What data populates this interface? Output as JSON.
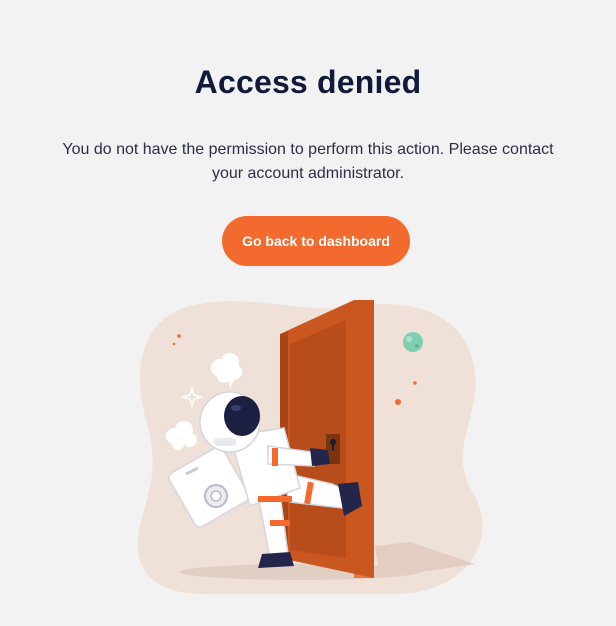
{
  "page": {
    "title": "Access denied",
    "message": "You do not have the permission to perform this action. Please contact your account administrator.",
    "cta_label": "Go back to dashboard"
  },
  "colors": {
    "background": "#f2f2f2",
    "title": "#121a3a",
    "accent": "#f26a2e",
    "blob": "#f0e1d8",
    "door": "#c9571f"
  },
  "illustration": {
    "icon": "astronaut-kicking-door-illustration"
  }
}
